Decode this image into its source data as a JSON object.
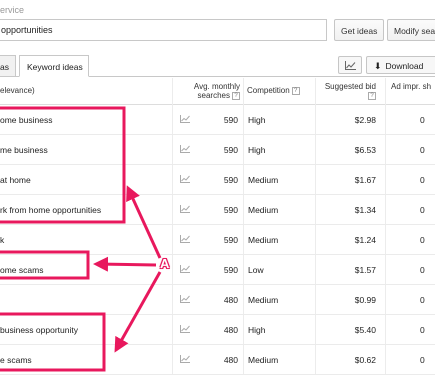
{
  "header": {
    "service_label": "ervice",
    "search_value": "opportunities",
    "get_ideas_label": "Get ideas",
    "modify_search_label": "Modify searc"
  },
  "tabs": [
    {
      "label": "as"
    },
    {
      "label": "Keyword ideas"
    }
  ],
  "toolbar": {
    "chart_icon": "line-chart-icon",
    "download_label": "Download"
  },
  "table": {
    "columns": {
      "relevance": "elevance)",
      "avg_monthly_1": "Avg. monthly",
      "avg_monthly_2": "searches",
      "competition": "Competition",
      "suggested_bid": "Suggested bid",
      "ad_impr": "Ad impr. sh"
    },
    "rows": [
      {
        "keyword": "ome business",
        "avg": "590",
        "competition": "High",
        "bid": "$2.98",
        "ad": "0"
      },
      {
        "keyword": "me business",
        "avg": "590",
        "competition": "High",
        "bid": "$6.53",
        "ad": "0"
      },
      {
        "keyword": "at home",
        "avg": "590",
        "competition": "Medium",
        "bid": "$1.67",
        "ad": "0"
      },
      {
        "keyword": "rk from home opportunities",
        "avg": "590",
        "competition": "Medium",
        "bid": "$1.34",
        "ad": "0"
      },
      {
        "keyword": "k",
        "avg": "590",
        "competition": "Medium",
        "bid": "$1.24",
        "ad": "0"
      },
      {
        "keyword": "ome scams",
        "avg": "590",
        "competition": "Low",
        "bid": "$1.57",
        "ad": "0"
      },
      {
        "keyword": "",
        "avg": "480",
        "competition": "Medium",
        "bid": "$0.99",
        "ad": "0"
      },
      {
        "keyword": "business opportunity",
        "avg": "480",
        "competition": "High",
        "bid": "$5.40",
        "ad": "0"
      },
      {
        "keyword": "e scams",
        "avg": "480",
        "competition": "Medium",
        "bid": "$0.62",
        "ad": "0"
      }
    ]
  },
  "annotation": {
    "label": "A",
    "color": "#e8185d"
  }
}
